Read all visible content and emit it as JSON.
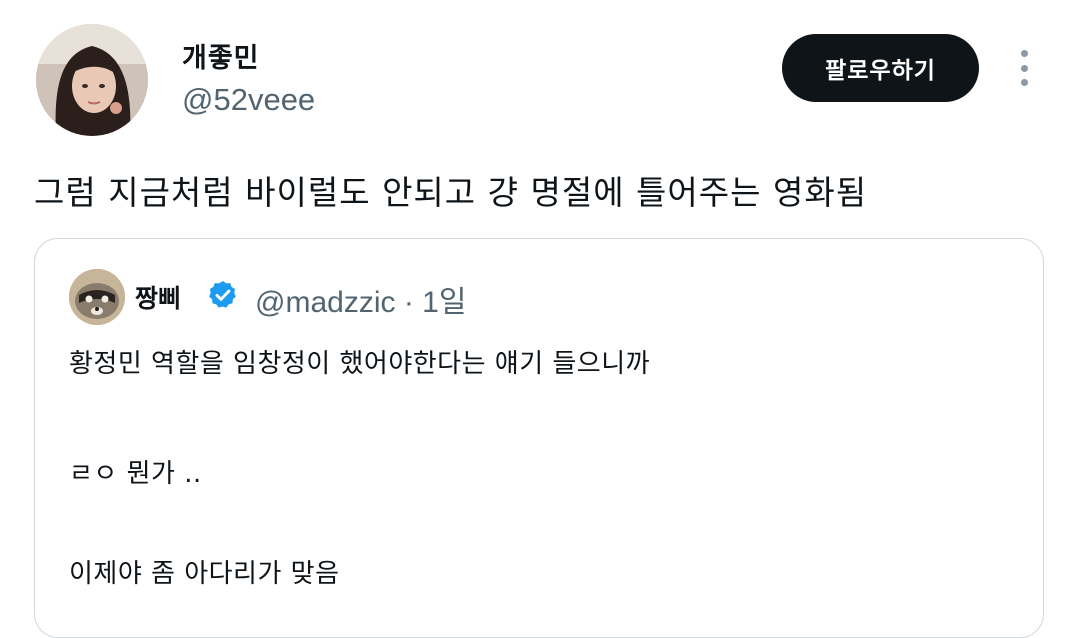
{
  "author": {
    "display_name": "개좋민",
    "handle": "@52veee"
  },
  "follow_label": "팔로우하기",
  "more_icon": "more-vertical-icon",
  "tweet_text": "그럼 지금처럼 바이럴도 안되고 걍 명절에 틀어주는 영화됨",
  "quoted": {
    "display_name": "짱삐",
    "verified": true,
    "handle": "@madzzic",
    "time": "· 1일",
    "lines": [
      "황정민 역할을 임창정이 했어야한다는 얘기 들으니까",
      "ㄹㅇ 뭔가 ..",
      "이제야 좀 아다리가 맞음"
    ]
  },
  "colors": {
    "text": "#0f1419",
    "muted": "#536471",
    "button_bg": "#0f1419",
    "verified": "#1d9bf0",
    "border": "#cfd9de"
  }
}
